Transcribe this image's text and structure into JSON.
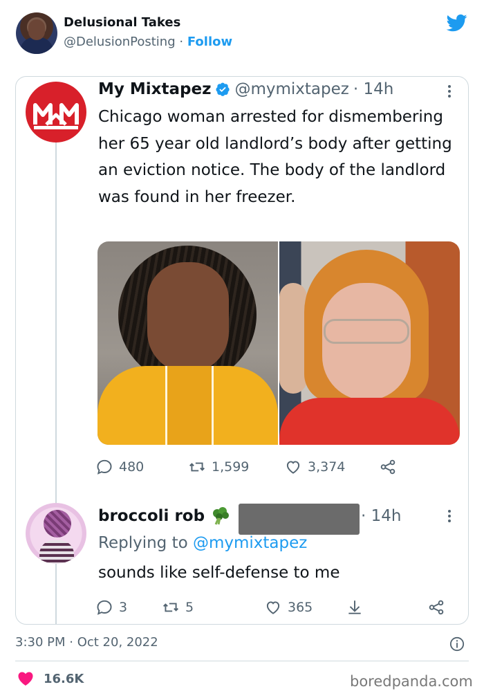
{
  "outer_tweet": {
    "author_name": "Delusional Takes",
    "author_handle": "@DelusionPosting",
    "separator": "·",
    "follow_label": "Follow",
    "timestamp": "3:30 PM · Oct 20, 2022",
    "likes_count": "16.6K"
  },
  "quoted_tweet": {
    "author_name": "My Mixtapez",
    "author_handle": "@mymixtapez",
    "time": "· 14h",
    "text": "Chicago woman arrested for dismembering her 65 year old landlord’s body after getting an eviction notice. The body of the landlord was found in her freezer.",
    "replies": "480",
    "retweets": "1,599",
    "likes": "3,374",
    "verified": true
  },
  "reply_tweet": {
    "author_name": "broccoli rob",
    "emoji_icon": "broccoli-icon",
    "time": "· 14h",
    "replying_label": "Replying to ",
    "replying_handle": "@mymixtapez",
    "text": "sounds like self-defense to me",
    "replies": "3",
    "retweets": "5",
    "likes": "365"
  },
  "watermark": "boredpanda.com",
  "colors": {
    "accent": "#1d9bf0",
    "muted": "#536471",
    "like_heart": "#f91880",
    "mm_brand": "#d8202a"
  }
}
